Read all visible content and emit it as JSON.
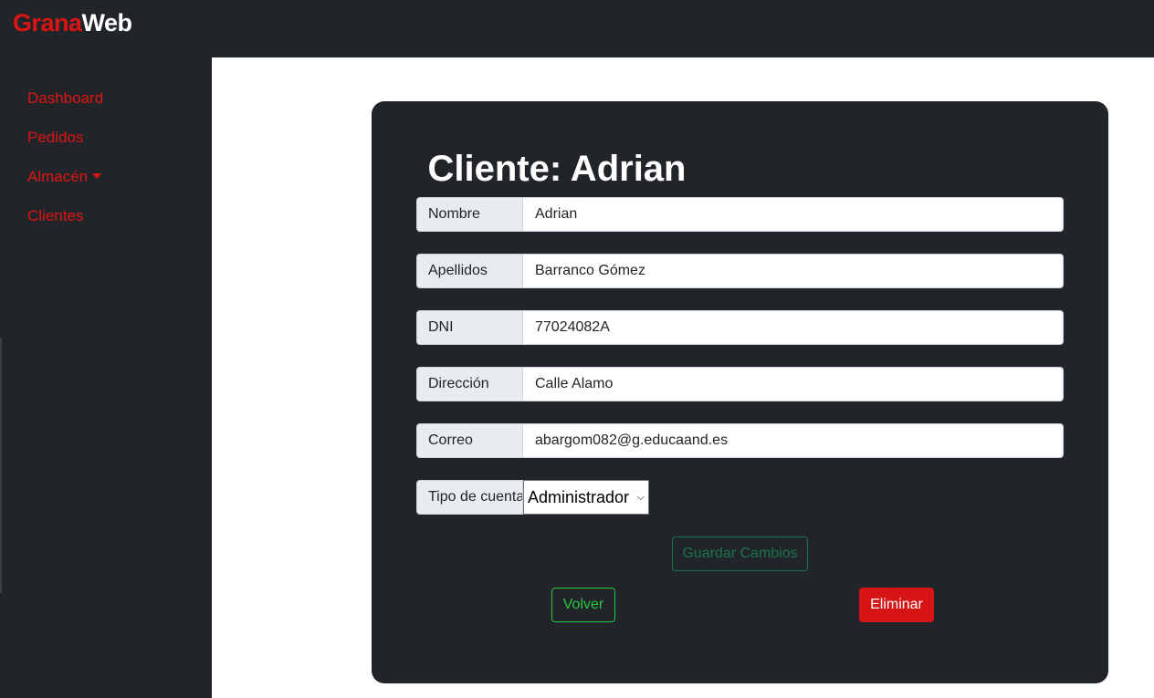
{
  "brand": {
    "part1": "Grana",
    "part2": "Web"
  },
  "sidebar": {
    "items": [
      {
        "label": "Dashboard"
      },
      {
        "label": "Pedidos"
      },
      {
        "label": "Almacén"
      },
      {
        "label": "Clientes"
      }
    ]
  },
  "form": {
    "title": "Cliente: Adrian",
    "fields": [
      {
        "label": "Nombre",
        "value": "Adrian"
      },
      {
        "label": "Apellidos",
        "value": "Barranco Gómez"
      },
      {
        "label": "DNI",
        "value": "77024082A"
      },
      {
        "label": "Dirección",
        "value": "Calle Alamo"
      },
      {
        "label": "Correo",
        "value": "abargom082@g.educaand.es"
      }
    ],
    "account_type": {
      "label": "Tipo de cuenta",
      "selected": "Administrador"
    },
    "save_label": "Guardar Cambios",
    "back_label": "Volver",
    "delete_label": "Eliminar"
  },
  "colors": {
    "dark_bg": "#212529",
    "accent_red": "#dc1414",
    "success_green": "#198754",
    "back_green": "#28c840"
  }
}
